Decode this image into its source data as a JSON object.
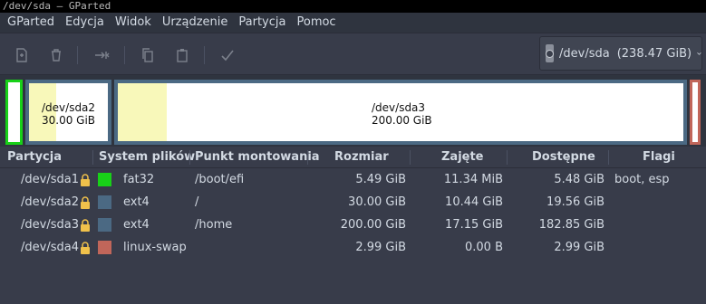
{
  "window": {
    "title": "/dev/sda – GParted"
  },
  "menu": [
    "GParted",
    "Edycja",
    "Widok",
    "Urządzenie",
    "Partycja",
    "Pomoc"
  ],
  "toolbar": {
    "new_icon": "new-partition-icon",
    "delete_icon": "delete-icon",
    "resize_icon": "resize-move-icon",
    "copy_icon": "copy-icon",
    "paste_icon": "paste-icon",
    "apply_icon": "apply-checkmark-icon"
  },
  "device": {
    "name": "/dev/sda",
    "size": "(238.47 GiB)"
  },
  "map": {
    "sda2": {
      "name": "/dev/sda2",
      "size": "30.00 GiB"
    },
    "sda3": {
      "name": "/dev/sda3",
      "size": "200.00 GiB"
    }
  },
  "table": {
    "headers": [
      "Partycja",
      "System plików",
      "Punkt montowania",
      "Rozmiar",
      "Zajęte",
      "Dostępne",
      "Flagi"
    ],
    "rows": [
      {
        "partition": "/dev/sda1",
        "fs": "fat32",
        "mount": "/boot/efi",
        "size": "5.49 GiB",
        "used": "11.34 MiB",
        "free": "5.48 GiB",
        "flags": "boot, esp"
      },
      {
        "partition": "/dev/sda2",
        "fs": "ext4",
        "mount": "/",
        "size": "30.00 GiB",
        "used": "10.44 GiB",
        "free": "19.56 GiB",
        "flags": ""
      },
      {
        "partition": "/dev/sda3",
        "fs": "ext4",
        "mount": "/home",
        "size": "200.00 GiB",
        "used": "17.15 GiB",
        "free": "182.85 GiB",
        "flags": ""
      },
      {
        "partition": "/dev/sda4",
        "fs": "linux-swap",
        "mount": "",
        "size": "2.99 GiB",
        "used": "0.00 B",
        "free": "2.99 GiB",
        "flags": ""
      }
    ]
  },
  "colors": {
    "fat32": "#18d118",
    "ext4": "#4b6983",
    "linux_swap": "#c1665a",
    "used": "#f8f8ba"
  }
}
